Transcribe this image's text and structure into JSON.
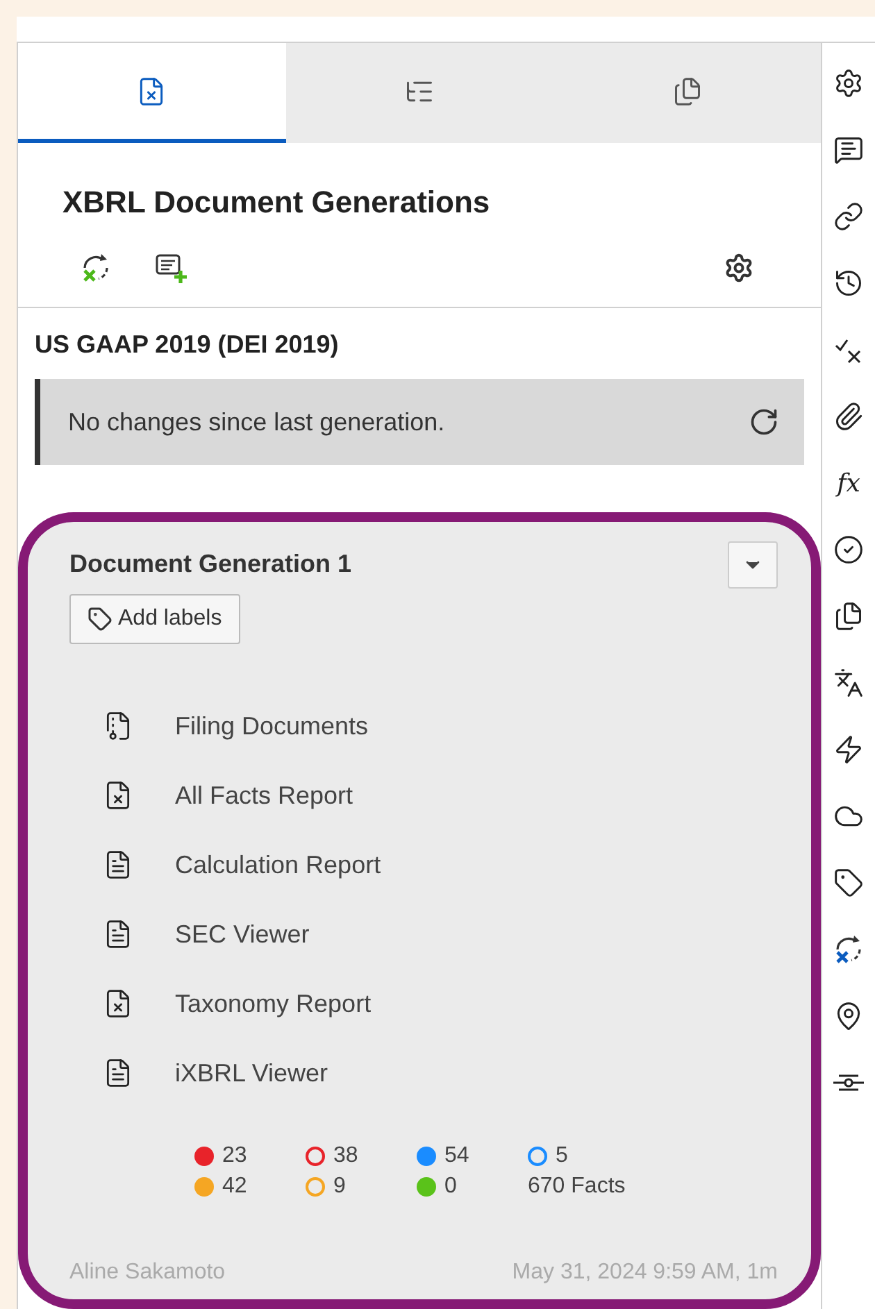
{
  "tabs": [
    {
      "kind": "xbrl",
      "selected": true
    },
    {
      "kind": "outline",
      "selected": false
    },
    {
      "kind": "documents",
      "selected": false
    }
  ],
  "panel": {
    "title": "XBRL Document Generations"
  },
  "taxonomy": {
    "name": "US GAAP 2019 (DEI 2019)",
    "notice": "No changes since last generation."
  },
  "generation": {
    "title": "Document Generation 1",
    "add_labels": "Add labels",
    "outputs": [
      {
        "kind": "package",
        "label": "Filing Documents"
      },
      {
        "kind": "spreadsheet",
        "label": "All Facts Report"
      },
      {
        "kind": "document",
        "label": "Calculation Report"
      },
      {
        "kind": "document",
        "label": "SEC Viewer"
      },
      {
        "kind": "spreadsheet",
        "label": "Taxonomy Report"
      },
      {
        "kind": "document",
        "label": "iXBRL Viewer"
      }
    ],
    "stats": [
      {
        "filled": true,
        "color": "#e8232a",
        "count": "23"
      },
      {
        "filled": false,
        "color": "#e8232a",
        "count": "38"
      },
      {
        "filled": true,
        "color": "#1a8cff",
        "count": "54"
      },
      {
        "filled": false,
        "color": "#1a8cff",
        "count": "5"
      },
      {
        "filled": true,
        "color": "#f5a623",
        "count": "42"
      },
      {
        "filled": false,
        "color": "#f5a623",
        "count": "9"
      },
      {
        "filled": true,
        "color": "#5ac21a",
        "count": "0"
      }
    ],
    "facts": "670 Facts",
    "author": "Aline Sakamoto",
    "timestamp": "May 31, 2024 9:59 AM, 1m"
  },
  "rail": [
    {
      "kind": "settings"
    },
    {
      "kind": "comment"
    },
    {
      "kind": "link"
    },
    {
      "kind": "history"
    },
    {
      "kind": "checkx"
    },
    {
      "kind": "paperclip"
    },
    {
      "kind": "glyph",
      "glyph": "fx"
    },
    {
      "kind": "check"
    },
    {
      "kind": "documents"
    },
    {
      "kind": "translate"
    },
    {
      "kind": "bolt"
    },
    {
      "kind": "cloud"
    },
    {
      "kind": "tag"
    },
    {
      "kind": "sync"
    },
    {
      "kind": "pin"
    },
    {
      "kind": "connector"
    }
  ]
}
